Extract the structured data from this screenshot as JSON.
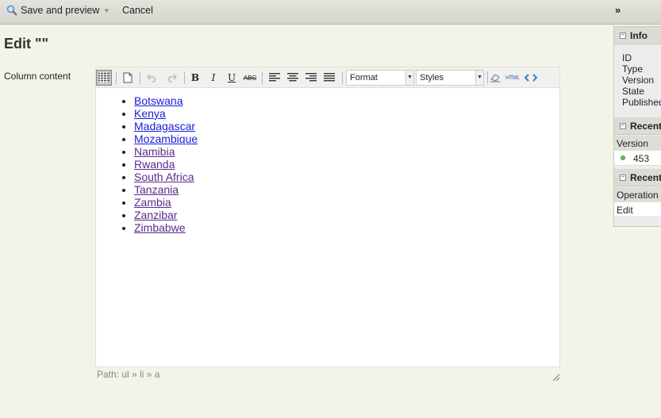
{
  "toolbar": {
    "save_label": "Save and preview",
    "cancel_label": "Cancel",
    "collapse_label": "»"
  },
  "page": {
    "title": "Edit \"\""
  },
  "form": {
    "column_label": "Column content"
  },
  "editor": {
    "format_label": "Format",
    "styles_label": "Styles",
    "html_label": "HTML",
    "path_label": "Path: ul » li » a",
    "list_items": [
      "Botswana",
      "Kenya",
      "Madagascar",
      "Mozambique",
      "Namibia",
      "Rwanda",
      "South Africa",
      "Tanzania",
      "Zambia",
      "Zanzibar",
      "Zimbabwe"
    ],
    "toolbar_icons": [
      "kitchen-sink-icon",
      "new-document-icon",
      "undo-icon",
      "redo-icon",
      "bold-icon",
      "italic-icon",
      "underline-icon",
      "strikethrough-icon",
      "align-left-icon",
      "align-center-icon",
      "align-right-icon",
      "align-justify-icon",
      "eraser-icon",
      "html-icon",
      "code-icon"
    ]
  },
  "sidebar": {
    "info": {
      "title": "Info",
      "fields": [
        "ID",
        "Type",
        "Version",
        "State",
        "Published"
      ]
    },
    "recent_versions": {
      "title": "Recent",
      "column": "Version",
      "value": "453"
    },
    "recent_operations": {
      "title": "Recent",
      "column": "Operation",
      "value": "Edit"
    }
  }
}
